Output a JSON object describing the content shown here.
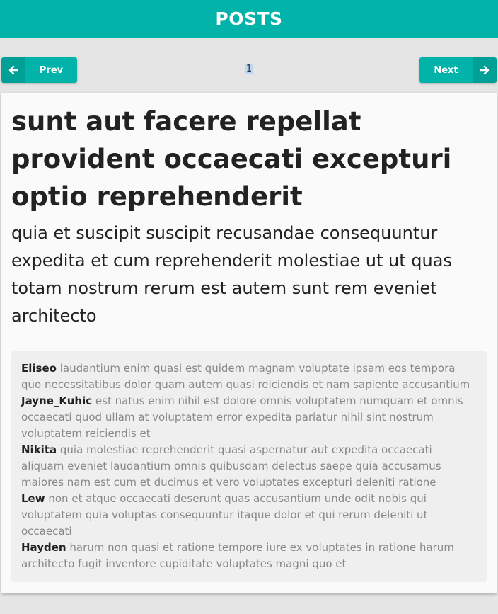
{
  "header": {
    "title": "POSTS"
  },
  "pagination": {
    "prev_label": "Prev",
    "next_label": "Next",
    "current_page": "1"
  },
  "post": {
    "title": "sunt aut facere repellat provident occaecati excepturi optio reprehenderit",
    "body": "quia et suscipit suscipit recusandae consequuntur expedita et cum reprehenderit molestiae ut ut quas totam nostrum rerum est autem sunt rem eveniet architecto"
  },
  "comments": [
    {
      "author": "Eliseo",
      "text": "laudantium enim quasi est quidem magnam voluptate ipsam eos tempora quo necessitatibus dolor quam autem quasi reiciendis et nam sapiente accusantium"
    },
    {
      "author": "Jayne_Kuhic",
      "text": "est natus enim nihil est dolore omnis voluptatem numquam et omnis occaecati quod ullam at voluptatem error expedita pariatur nihil sint nostrum voluptatem reiciendis et"
    },
    {
      "author": "Nikita",
      "text": "quia molestiae reprehenderit quasi aspernatur aut expedita occaecati aliquam eveniet laudantium omnis quibusdam delectus saepe quia accusamus maiores nam est cum et ducimus et vero voluptates excepturi deleniti ratione"
    },
    {
      "author": "Lew",
      "text": "non et atque occaecati deserunt quas accusantium unde odit nobis qui voluptatem quia voluptas consequuntur itaque dolor et qui rerum deleniti ut occaecati"
    },
    {
      "author": "Hayden",
      "text": "harum non quasi et ratione tempore iure ex voluptates in ratione harum architecto fugit inventore cupiditate voluptates magni quo et"
    }
  ],
  "colors": {
    "accent": "#02b3a9",
    "background": "#e5e5e5",
    "card": "#fafafa",
    "comments_bg": "#efefef"
  },
  "icons": {
    "prev": "arrow-left-icon",
    "next": "arrow-right-icon"
  }
}
